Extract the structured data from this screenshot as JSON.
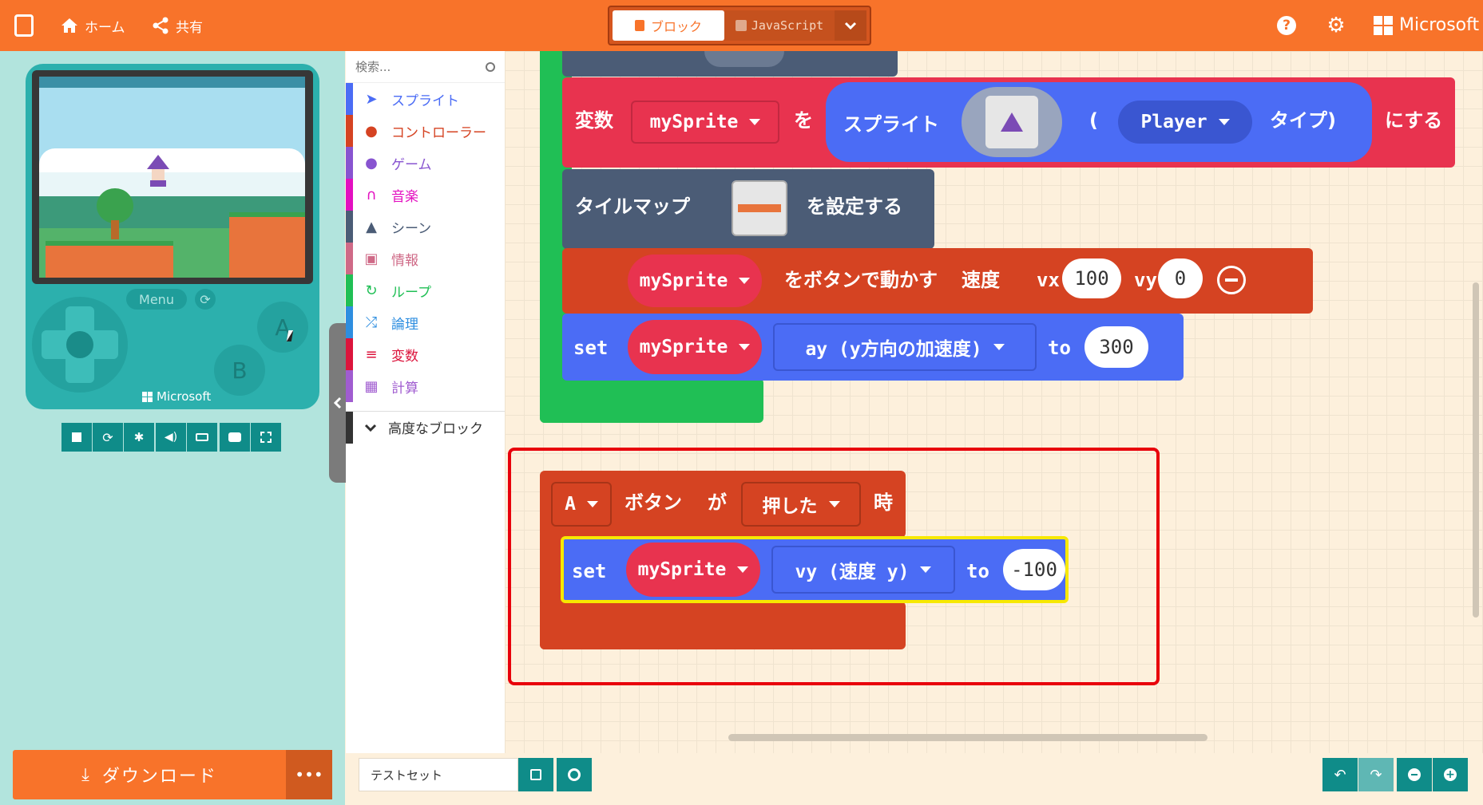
{
  "header": {
    "home_label": "ホーム",
    "share_label": "共有",
    "tab_blocks": "ブロック",
    "tab_javascript": "JavaScript",
    "brand": "Microsoft"
  },
  "simulator": {
    "menu_label": "Menu",
    "a_label": "A",
    "b_label": "B",
    "brand": "Microsoft"
  },
  "download": {
    "label": "ダウンロード",
    "more": "•••"
  },
  "toolbox": {
    "search_placeholder": "検索...",
    "categories": [
      {
        "label": "スプライト",
        "color": "#4b6cf5",
        "icon": "paper-plane-icon"
      },
      {
        "label": "コントローラー",
        "color": "#d54322",
        "icon": "gamepad-icon"
      },
      {
        "label": "ゲーム",
        "color": "#8854d0",
        "icon": "circle-icon"
      },
      {
        "label": "音楽",
        "color": "#e30fc0",
        "icon": "headphones-icon"
      },
      {
        "label": "シーン",
        "color": "#4b5c76",
        "icon": "tree-icon"
      },
      {
        "label": "情報",
        "color": "#cf6a87",
        "icon": "id-card-icon"
      },
      {
        "label": "ループ",
        "color": "#20bf55",
        "icon": "loop-icon"
      },
      {
        "label": "論理",
        "color": "#2e8ee0",
        "icon": "shuffle-icon"
      },
      {
        "label": "変数",
        "color": "#dc143c",
        "icon": "list-icon"
      },
      {
        "label": "計算",
        "color": "#a05cd0",
        "icon": "calculator-icon"
      }
    ],
    "advanced": "高度なブロック"
  },
  "blocks": {
    "set_var": {
      "kw": "変数",
      "var": "mySprite",
      "wo": "を",
      "sprite": "スプライト",
      "paren_open": "(",
      "kind": "Player",
      "type": "タイプ)",
      "suffix": "にする"
    },
    "tilemap": {
      "label": "タイルマップ",
      "suffix": "を設定する"
    },
    "move": {
      "sprite": "mySprite",
      "text": "をボタンで動かす",
      "speed": "速度",
      "vx": "vx",
      "vx_val": "100",
      "vy": "vy",
      "vy_val": "0"
    },
    "set_ay": {
      "kw": "set",
      "sprite": "mySprite",
      "prop": "ay (y方向の加速度)",
      "to": "to",
      "val": "300"
    },
    "event": {
      "button": "A",
      "label": "ボタン",
      "ga": "が",
      "action": "押した",
      "toki": "時"
    },
    "set_vy": {
      "kw": "set",
      "sprite": "mySprite",
      "prop": "vy (速度 y)",
      "to": "to",
      "val": "-100"
    }
  },
  "footer": {
    "project_name": "テストセット"
  },
  "colors": {
    "accent": "#f8732a",
    "highlight": "#e8000b",
    "teal": "#0f8c89"
  }
}
